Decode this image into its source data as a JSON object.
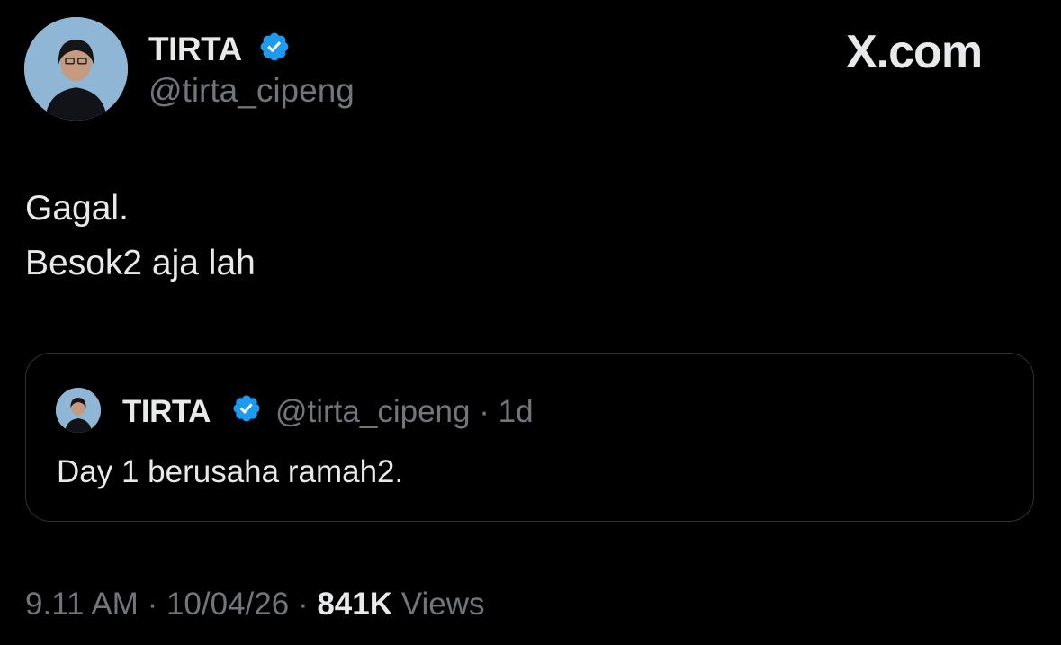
{
  "header": {
    "display_name": "TIRTA",
    "handle": "@tirta_cipeng",
    "verified_icon": "verified-badge-icon",
    "logo_text": "X.com"
  },
  "tweet": {
    "lines": [
      "Gagal.",
      "Besok2 aja lah"
    ]
  },
  "quoted_tweet": {
    "display_name": "TIRTA",
    "handle": "@tirta_cipeng",
    "separator": "·",
    "age": "1d",
    "text": "Day 1 berusaha ramah2."
  },
  "footer": {
    "time": "9.11 AM",
    "separator": "·",
    "date": "10/04/26",
    "views_count": "841K",
    "views_label": "Views"
  },
  "colors": {
    "background": "#000000",
    "primary_text": "#e7e9ea",
    "secondary_text": "#71767b",
    "verified_blue": "#1d9bf0",
    "border": "#2f3336"
  }
}
